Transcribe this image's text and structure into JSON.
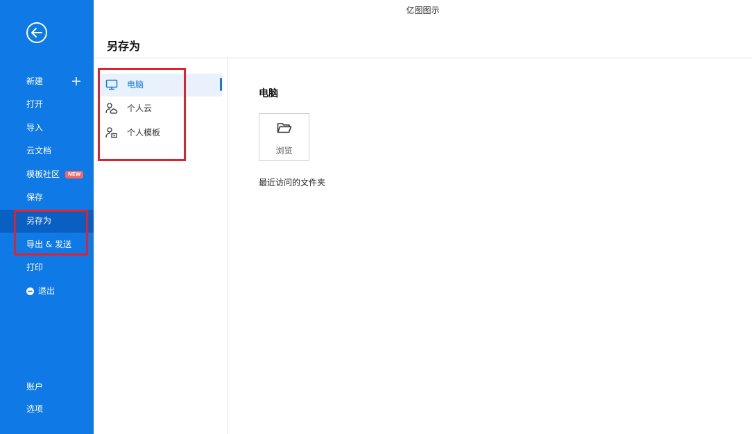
{
  "app": {
    "title": "亿图图示"
  },
  "page": {
    "title": "另存为"
  },
  "sidebar": {
    "items": [
      {
        "label": "新建"
      },
      {
        "label": "打开"
      },
      {
        "label": "导入"
      },
      {
        "label": "云文档"
      },
      {
        "label": "模板社区",
        "badge": "NEW"
      },
      {
        "label": "保存"
      },
      {
        "label": "另存为"
      },
      {
        "label": "导出 & 发送"
      },
      {
        "label": "打印"
      },
      {
        "label": "退出"
      },
      {
        "label": "账户"
      },
      {
        "label": "选项"
      }
    ]
  },
  "locations": {
    "items": [
      {
        "label": "电脑",
        "icon": "monitor-icon"
      },
      {
        "label": "个人云",
        "icon": "user-cloud-icon"
      },
      {
        "label": "个人模板",
        "icon": "user-template-icon"
      }
    ]
  },
  "main": {
    "section_title": "电脑",
    "browse_label": "浏览",
    "recent_title": "最近访问的文件夹"
  },
  "colors": {
    "sidebar_bg": "#0f7ae5",
    "sidebar_active": "#0a5fc2",
    "accent": "#0f7ae5",
    "highlight_box": "#e4202b",
    "new_badge": "#f86464"
  }
}
